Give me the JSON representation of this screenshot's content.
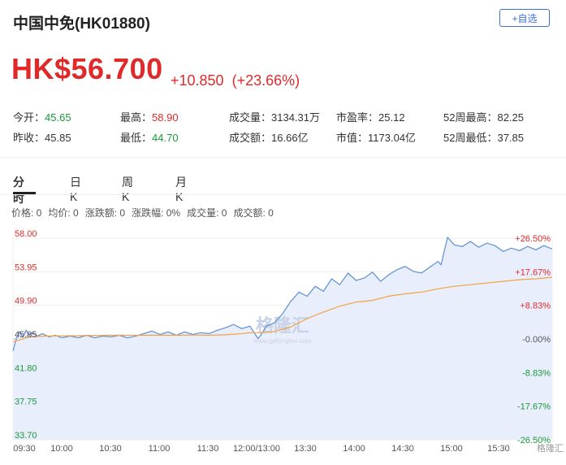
{
  "header": {
    "title": "中国中免(HK01880)",
    "watch_label": "+自选"
  },
  "quote": {
    "price": "HK$56.700",
    "change": "+10.850",
    "change_pct": "(+23.66%)"
  },
  "stats": [
    {
      "label": "今开：",
      "value": "45.65",
      "tone": "down"
    },
    {
      "label": "最高：",
      "value": "58.90",
      "tone": "up"
    },
    {
      "label": "成交量：",
      "value": "3134.31万",
      "tone": "flat"
    },
    {
      "label": "市盈率：",
      "value": "25.12",
      "tone": "flat"
    },
    {
      "label": "52周最高：",
      "value": "82.25",
      "tone": "flat"
    },
    {
      "label": "昨收：",
      "value": "45.85",
      "tone": "flat"
    },
    {
      "label": "最低：",
      "value": "44.70",
      "tone": "down"
    },
    {
      "label": "成交额：",
      "value": "16.66亿",
      "tone": "flat"
    },
    {
      "label": "市值：",
      "value": "1173.04亿",
      "tone": "flat"
    },
    {
      "label": "52周最低：",
      "value": "37.85",
      "tone": "flat"
    }
  ],
  "tabs": [
    {
      "label": "分时",
      "active": true
    },
    {
      "label": "日K",
      "active": false
    },
    {
      "label": "周K",
      "active": false
    },
    {
      "label": "月K",
      "active": false
    }
  ],
  "infobar": [
    {
      "label": "价格:",
      "value": "0"
    },
    {
      "label": "均价:",
      "value": "0"
    },
    {
      "label": "涨跌额:",
      "value": "0"
    },
    {
      "label": "涨跌幅:",
      "value": "0%"
    },
    {
      "label": "成交量:",
      "value": "0"
    },
    {
      "label": "成交额:",
      "value": "0"
    }
  ],
  "watermark": "格隆汇",
  "watermark_url": "www.gelonghui.com",
  "corner_watermark": "格隆汇",
  "colors": {
    "up": "#e02a2a",
    "down": "#1a9a3a",
    "price_line": "#5b8fd6",
    "avg_line": "#f4a340",
    "fill": "#e8eefb",
    "accent": "#3a6fd8"
  },
  "chart_data": {
    "type": "line",
    "title": "",
    "y_left_ticks": [
      "58.00",
      "53.95",
      "49.90",
      "45.85",
      "41.80",
      "37.75",
      "33.70"
    ],
    "y_right_ticks": [
      "+26.50%",
      "+17.67%",
      "+8.83%",
      "-0.00%",
      "-8.83%",
      "-17.67%",
      "-26.50%"
    ],
    "x_ticks": [
      "09:30",
      "10:00",
      "10:30",
      "11:00",
      "11:30",
      "12:00/13:00",
      "13:30",
      "14:00",
      "14:30",
      "15:00",
      "15:30"
    ],
    "ylim": [
      33.7,
      58.0
    ],
    "prev_close": 45.85,
    "x_range": [
      0,
      330
    ],
    "series": [
      {
        "role": "price",
        "x": [
          0,
          2,
          4,
          6,
          8,
          10,
          12,
          15,
          18,
          22,
          26,
          30,
          35,
          40,
          45,
          50,
          55,
          60,
          65,
          70,
          75,
          80,
          85,
          90,
          95,
          100,
          105,
          110,
          115,
          120,
          125,
          130,
          135,
          140,
          145,
          148,
          150,
          152,
          155,
          160,
          165,
          170,
          175,
          180,
          185,
          190,
          195,
          200,
          205,
          210,
          215,
          220,
          225,
          230,
          235,
          240,
          245,
          250,
          255,
          260,
          262,
          264,
          266,
          270,
          275,
          280,
          285,
          290,
          295,
          300,
          305,
          310,
          315,
          320,
          325,
          330
        ],
        "y": [
          44.4,
          45.9,
          46.7,
          46.1,
          46.9,
          46.3,
          46.6,
          46.2,
          46.5,
          46.1,
          46.3,
          46.0,
          46.2,
          46.0,
          46.3,
          46.0,
          46.2,
          46.1,
          46.3,
          46.0,
          46.2,
          46.5,
          46.8,
          46.4,
          46.7,
          46.3,
          46.7,
          46.4,
          46.6,
          46.5,
          46.9,
          47.2,
          47.6,
          47.1,
          47.4,
          46.5,
          45.9,
          46.4,
          47.4,
          47.8,
          48.9,
          50.4,
          51.5,
          51.0,
          52.2,
          51.6,
          53.1,
          52.4,
          53.8,
          52.9,
          53.2,
          53.9,
          52.8,
          53.6,
          54.2,
          54.6,
          54.0,
          53.8,
          54.5,
          55.2,
          54.8,
          56.5,
          58.1,
          57.2,
          57.0,
          57.6,
          56.9,
          57.4,
          57.1,
          56.4,
          56.8,
          56.5,
          57.0,
          56.6,
          57.1,
          56.7
        ]
      },
      {
        "role": "average",
        "x": [
          0,
          10,
          20,
          40,
          60,
          80,
          100,
          110,
          120,
          130,
          140,
          145,
          150,
          160,
          170,
          180,
          190,
          200,
          210,
          220,
          230,
          240,
          250,
          260,
          270,
          280,
          290,
          300,
          310,
          320,
          330
        ],
        "y": [
          45.5,
          46.1,
          46.2,
          46.25,
          46.3,
          46.3,
          46.3,
          46.32,
          46.3,
          46.35,
          46.5,
          46.6,
          46.6,
          46.75,
          47.3,
          48.3,
          49.1,
          49.8,
          50.3,
          50.5,
          51.0,
          51.3,
          51.5,
          51.9,
          52.2,
          52.4,
          52.6,
          52.8,
          53.0,
          53.1,
          53.3
        ]
      }
    ]
  }
}
